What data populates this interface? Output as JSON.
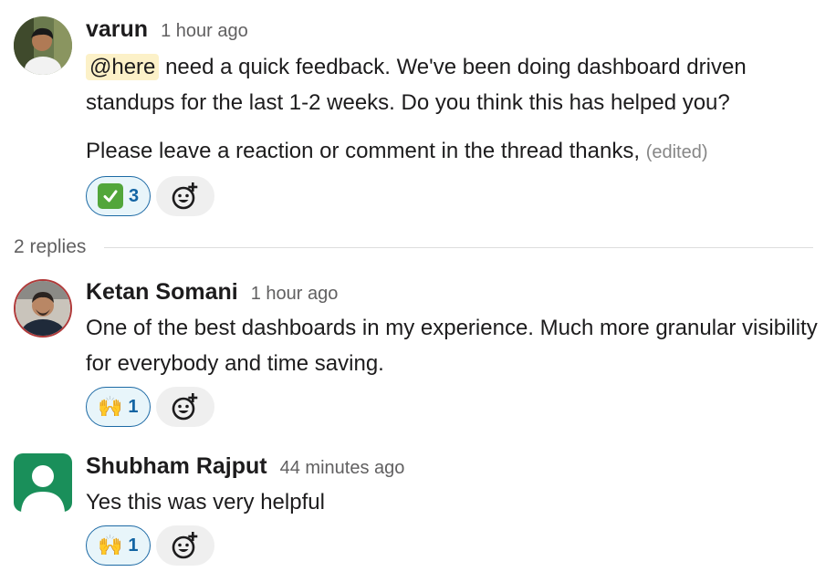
{
  "messages": [
    {
      "author": "varun",
      "time": "1 hour ago",
      "mention": "@here",
      "line1_rest": " need a quick feedback. We've been doing dashboard driven standups for the last 1-2 weeks. Do you think this has helped you?",
      "line2": "Please leave a reaction or comment in the thread thanks, ",
      "edited": "(edited)",
      "reaction": {
        "emoji": "white-check-mark",
        "count": "3"
      }
    },
    {
      "author": "Ketan Somani",
      "time": "1 hour ago",
      "text": "One of the best dashboards in my experience. Much more granular visibility for everybody and time saving.",
      "reaction": {
        "emoji": "raised-hands",
        "glyph": "🙌",
        "count": "1"
      }
    },
    {
      "author": "Shubham Rajput",
      "time": "44 minutes ago",
      "text": "Yes this was very helpful",
      "reaction": {
        "emoji": "raised-hands",
        "glyph": "🙌",
        "count": "1"
      }
    }
  ],
  "thread": {
    "replies_label": "2 replies"
  },
  "colors": {
    "mention_bg": "#fcf1c8",
    "reaction_bg": "#e8f5fa",
    "reaction_border": "#1d6aa5",
    "reaction_count": "#1264a3",
    "default_avatar": "#1a8f5a"
  }
}
